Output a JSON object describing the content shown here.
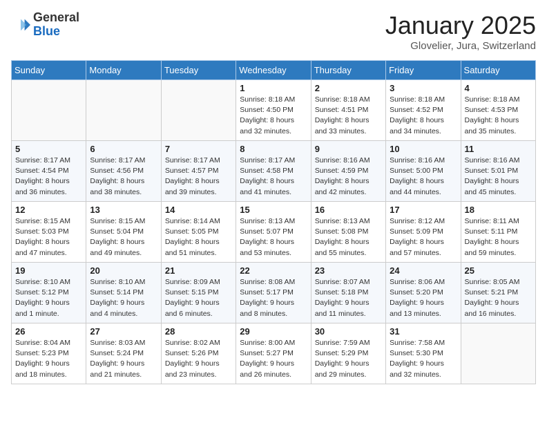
{
  "header": {
    "logo_general": "General",
    "logo_blue": "Blue",
    "month": "January 2025",
    "location": "Glovelier, Jura, Switzerland"
  },
  "weekdays": [
    "Sunday",
    "Monday",
    "Tuesday",
    "Wednesday",
    "Thursday",
    "Friday",
    "Saturday"
  ],
  "weeks": [
    [
      {
        "day": "",
        "info": ""
      },
      {
        "day": "",
        "info": ""
      },
      {
        "day": "",
        "info": ""
      },
      {
        "day": "1",
        "info": "Sunrise: 8:18 AM\nSunset: 4:50 PM\nDaylight: 8 hours\nand 32 minutes."
      },
      {
        "day": "2",
        "info": "Sunrise: 8:18 AM\nSunset: 4:51 PM\nDaylight: 8 hours\nand 33 minutes."
      },
      {
        "day": "3",
        "info": "Sunrise: 8:18 AM\nSunset: 4:52 PM\nDaylight: 8 hours\nand 34 minutes."
      },
      {
        "day": "4",
        "info": "Sunrise: 8:18 AM\nSunset: 4:53 PM\nDaylight: 8 hours\nand 35 minutes."
      }
    ],
    [
      {
        "day": "5",
        "info": "Sunrise: 8:17 AM\nSunset: 4:54 PM\nDaylight: 8 hours\nand 36 minutes."
      },
      {
        "day": "6",
        "info": "Sunrise: 8:17 AM\nSunset: 4:56 PM\nDaylight: 8 hours\nand 38 minutes."
      },
      {
        "day": "7",
        "info": "Sunrise: 8:17 AM\nSunset: 4:57 PM\nDaylight: 8 hours\nand 39 minutes."
      },
      {
        "day": "8",
        "info": "Sunrise: 8:17 AM\nSunset: 4:58 PM\nDaylight: 8 hours\nand 41 minutes."
      },
      {
        "day": "9",
        "info": "Sunrise: 8:16 AM\nSunset: 4:59 PM\nDaylight: 8 hours\nand 42 minutes."
      },
      {
        "day": "10",
        "info": "Sunrise: 8:16 AM\nSunset: 5:00 PM\nDaylight: 8 hours\nand 44 minutes."
      },
      {
        "day": "11",
        "info": "Sunrise: 8:16 AM\nSunset: 5:01 PM\nDaylight: 8 hours\nand 45 minutes."
      }
    ],
    [
      {
        "day": "12",
        "info": "Sunrise: 8:15 AM\nSunset: 5:03 PM\nDaylight: 8 hours\nand 47 minutes."
      },
      {
        "day": "13",
        "info": "Sunrise: 8:15 AM\nSunset: 5:04 PM\nDaylight: 8 hours\nand 49 minutes."
      },
      {
        "day": "14",
        "info": "Sunrise: 8:14 AM\nSunset: 5:05 PM\nDaylight: 8 hours\nand 51 minutes."
      },
      {
        "day": "15",
        "info": "Sunrise: 8:13 AM\nSunset: 5:07 PM\nDaylight: 8 hours\nand 53 minutes."
      },
      {
        "day": "16",
        "info": "Sunrise: 8:13 AM\nSunset: 5:08 PM\nDaylight: 8 hours\nand 55 minutes."
      },
      {
        "day": "17",
        "info": "Sunrise: 8:12 AM\nSunset: 5:09 PM\nDaylight: 8 hours\nand 57 minutes."
      },
      {
        "day": "18",
        "info": "Sunrise: 8:11 AM\nSunset: 5:11 PM\nDaylight: 8 hours\nand 59 minutes."
      }
    ],
    [
      {
        "day": "19",
        "info": "Sunrise: 8:10 AM\nSunset: 5:12 PM\nDaylight: 9 hours\nand 1 minute."
      },
      {
        "day": "20",
        "info": "Sunrise: 8:10 AM\nSunset: 5:14 PM\nDaylight: 9 hours\nand 4 minutes."
      },
      {
        "day": "21",
        "info": "Sunrise: 8:09 AM\nSunset: 5:15 PM\nDaylight: 9 hours\nand 6 minutes."
      },
      {
        "day": "22",
        "info": "Sunrise: 8:08 AM\nSunset: 5:17 PM\nDaylight: 9 hours\nand 8 minutes."
      },
      {
        "day": "23",
        "info": "Sunrise: 8:07 AM\nSunset: 5:18 PM\nDaylight: 9 hours\nand 11 minutes."
      },
      {
        "day": "24",
        "info": "Sunrise: 8:06 AM\nSunset: 5:20 PM\nDaylight: 9 hours\nand 13 minutes."
      },
      {
        "day": "25",
        "info": "Sunrise: 8:05 AM\nSunset: 5:21 PM\nDaylight: 9 hours\nand 16 minutes."
      }
    ],
    [
      {
        "day": "26",
        "info": "Sunrise: 8:04 AM\nSunset: 5:23 PM\nDaylight: 9 hours\nand 18 minutes."
      },
      {
        "day": "27",
        "info": "Sunrise: 8:03 AM\nSunset: 5:24 PM\nDaylight: 9 hours\nand 21 minutes."
      },
      {
        "day": "28",
        "info": "Sunrise: 8:02 AM\nSunset: 5:26 PM\nDaylight: 9 hours\nand 23 minutes."
      },
      {
        "day": "29",
        "info": "Sunrise: 8:00 AM\nSunset: 5:27 PM\nDaylight: 9 hours\nand 26 minutes."
      },
      {
        "day": "30",
        "info": "Sunrise: 7:59 AM\nSunset: 5:29 PM\nDaylight: 9 hours\nand 29 minutes."
      },
      {
        "day": "31",
        "info": "Sunrise: 7:58 AM\nSunset: 5:30 PM\nDaylight: 9 hours\nand 32 minutes."
      },
      {
        "day": "",
        "info": ""
      }
    ]
  ]
}
